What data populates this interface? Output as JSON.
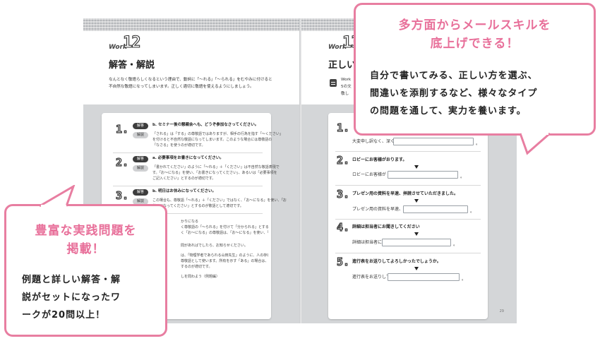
{
  "left_page": {
    "work_label": "Work",
    "work_number": "12",
    "heading": "解答・解説",
    "intro_lines": [
      "なんとなく敬語らしくなるという理由で、動詞に「～れる」「～られる」をむやみに付けると",
      "不自然な敬語になってしまいます。正しく適切に敬語を使えるようにしましょう。"
    ],
    "items": [
      {
        "number": "1.",
        "tag1": "解答",
        "tag2": "解説",
        "answer": "b. セミナー後の懇親会へも、どうぞ参加なさってください。",
        "explanation": [
          "「される」は「する」の尊敬語ではありますが、相手の行為を指す「～ください」",
          "を付けると不自然な敬語になってしまいます。このような場合には尊敬語の",
          "「なさる」を使うのが適切です。"
        ]
      },
      {
        "number": "2.",
        "tag1": "解答",
        "tag2": "解説",
        "answer": "a. 必要事項をお書きになってください。",
        "explanation": [
          "「書かれてください」のように「～れる」＋「ください」は不自然な敬語表現で",
          "す。「お～になる」を使い、「お書きになってください」、あるいは「必要事項を",
          "ご記入ください」とするのが適切です。"
        ]
      },
      {
        "number": "3.",
        "tag1": "解答",
        "tag2": "解説",
        "answer": "b. 明日はお休みになってください。",
        "explanation": [
          "この場合も、尊敬語「～れる」＋「ください」ではなく、「お～になる」を使い、「お",
          "休みになってください」とするのが敬語として適切です。"
        ]
      }
    ],
    "partial_lines": [
      "かりになる",
      "く尊敬語の「～られる」を付けて「分かられる」とするのは不自然で",
      "く「お～になる」の尊敬語は、「お～になる」を使い、「おわかりになる」とするのが",
      "問があればでしたら、お知らせください。",
      "は、「物理学者であられる山田先生」のように、人の存在を示す「あ",
      "尊敬語として使います。所有を示す「ある」の場合は、「おありになる」に",
      "するのが適切です。",
      "しを問わよう（例題編）"
    ]
  },
  "right_page": {
    "work_label": "Work",
    "work_number": "13",
    "heading": "正しい",
    "sub_lines": [
      "Work",
      "5の文",
      "敬し"
    ],
    "items": [
      {
        "number": "1.",
        "question": "",
        "label": "大変申し訳なく、深く",
        "suffix": "。"
      },
      {
        "number": "2.",
        "question": "ロビーにお客様がおります。",
        "label": "ロビーにお客様が",
        "suffix": "。"
      },
      {
        "number": "3.",
        "question": "プレゼン用の資料を早速、拝読させていただきました。",
        "label": "プレゼン用の資料を早速、",
        "suffix": "。"
      },
      {
        "number": "4.",
        "question": "詳細は担当者にお聞きしてください",
        "label": "詳細は担当者に",
        "suffix": "。"
      },
      {
        "number": "5.",
        "question": "進行表をお送りしてよろしかったでしょうか。",
        "label": "進行表をお送りして",
        "suffix": "。"
      }
    ],
    "page_number": "29"
  },
  "callout_top_right": {
    "title_lines": [
      "多方面からメールスキルを",
      "底上げできる！"
    ],
    "body_lines": [
      "自分で書いてみる、正しい方を選ぶ、",
      "間違いを添削するなど、様々なタイプ",
      "の問題を通して、実力を養います。"
    ]
  },
  "callout_bottom_left": {
    "title_lines": [
      "豊富な実践問題を",
      "掲載！"
    ],
    "body_lines": [
      "例題と詳しい解答・解",
      "説がセットになったワ",
      "ークが20問以上！"
    ]
  },
  "colors": {
    "accent_pink": "#e87ea1",
    "title_pink": "#e8709a",
    "grey_area": "#d4d6d8"
  }
}
